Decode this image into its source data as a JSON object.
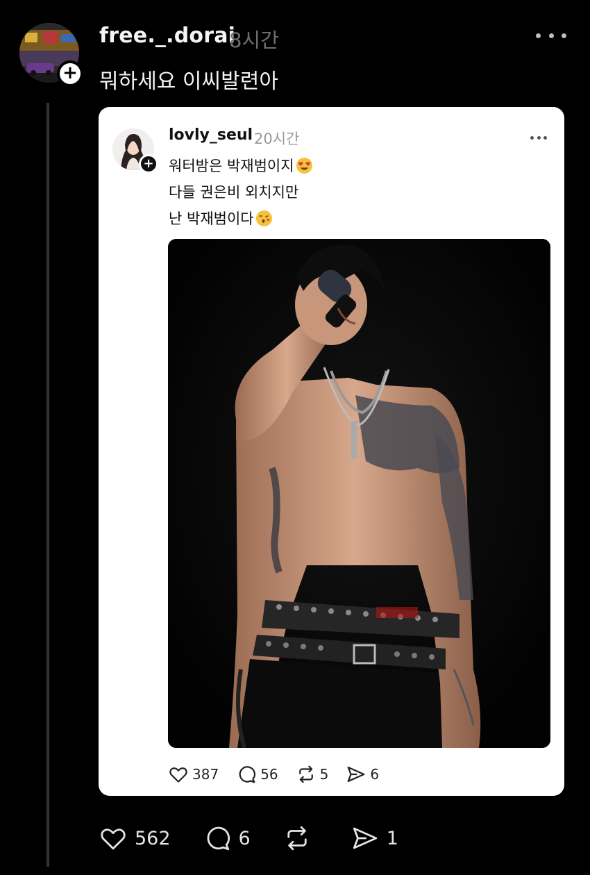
{
  "post": {
    "username": "free._.dorai",
    "timestamp": "8시간",
    "text": "뭐하세요 이씨발련아",
    "follow_symbol": "+",
    "likes": "562",
    "replies": "6",
    "reposts": "",
    "shares": "1"
  },
  "quote": {
    "username": "lovly_seul",
    "timestamp": "20시간",
    "follow_symbol": "+",
    "line1": "워터밤은 박재범이지",
    "line2": "다들 권은비 외치지만",
    "line3": "난 박재범이다",
    "line1_emoji": "heart-eyes-emoji",
    "line3_emoji": "kissing-heart-emoji",
    "likes": "387",
    "replies": "56",
    "reposts": "5",
    "shares": "6"
  },
  "colors": {
    "background": "#000000",
    "card": "#ffffff",
    "muted": "#6e6e6e",
    "thread_line": "#333333"
  }
}
